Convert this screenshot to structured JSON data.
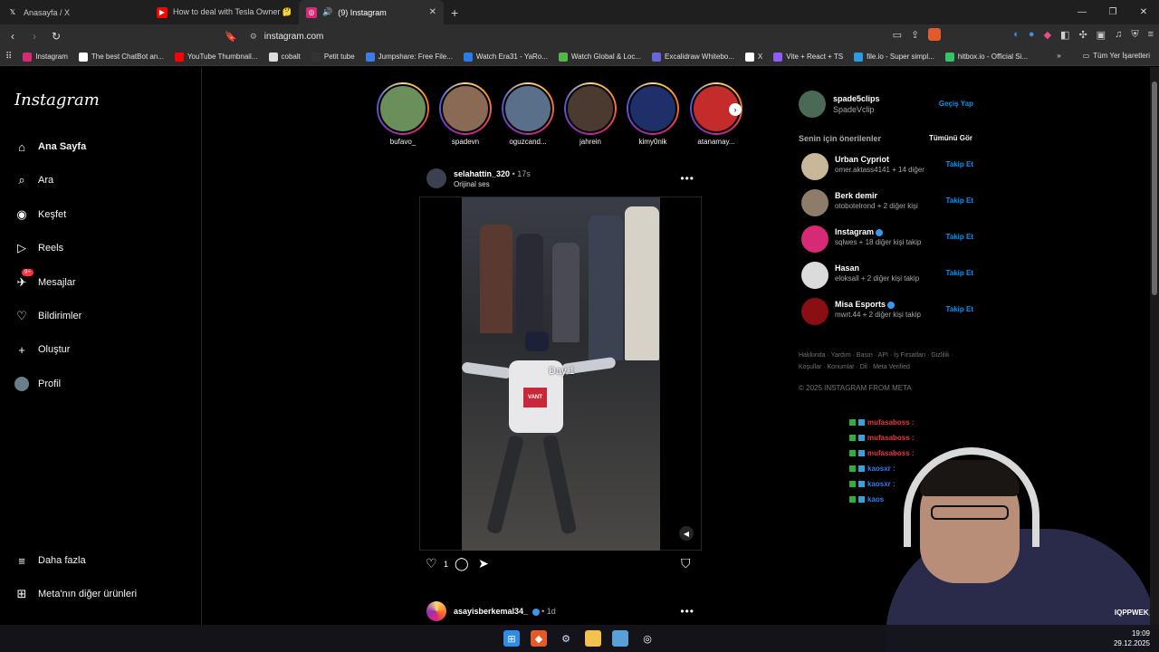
{
  "browser": {
    "tabs": [
      {
        "label": "Anasayfa / X",
        "icon": "x-icon"
      },
      {
        "label": "How to deal with Tesla Owner 🤔 #s",
        "icon": "youtube-icon"
      },
      {
        "label": "(9) Instagram",
        "icon": "instagram-icon"
      }
    ],
    "url": "instagram.com",
    "bookmarks": [
      {
        "label": "Instagram",
        "color": "#d62976"
      },
      {
        "label": "The best ChatBot an...",
        "color": "#ffffff"
      },
      {
        "label": "YouTube Thumbnail...",
        "color": "#ff0000"
      },
      {
        "label": "cobalt",
        "color": "#dddddd"
      },
      {
        "label": "Petit tube",
        "color": "#333333"
      },
      {
        "label": "Jumpshare: Free File...",
        "color": "#3d7be8"
      },
      {
        "label": "Watch Era31 - YaRo...",
        "color": "#2a7be4"
      },
      {
        "label": "Watch Global & Loc...",
        "color": "#53b848"
      },
      {
        "label": "Excalidraw Whitebo...",
        "color": "#6965db"
      },
      {
        "label": "X",
        "color": "#ffffff"
      },
      {
        "label": "Vite + React + TS",
        "color": "#8e5cf6"
      },
      {
        "label": "file.io - Super simpl...",
        "color": "#2c9be0"
      },
      {
        "label": "hitbox.io - Official Si...",
        "color": "#33c46a"
      }
    ],
    "all_bookmarks": "Tüm Yer İşaretleri"
  },
  "sidebar": {
    "logo": "Instagram",
    "items": [
      {
        "label": "Ana Sayfa",
        "icon": "home-icon"
      },
      {
        "label": "Ara",
        "icon": "search-icon"
      },
      {
        "label": "Keşfet",
        "icon": "compass-icon"
      },
      {
        "label": "Reels",
        "icon": "reels-icon"
      },
      {
        "label": "Mesajlar",
        "icon": "messenger-icon",
        "badge": "9+"
      },
      {
        "label": "Bildirimler",
        "icon": "heart-icon"
      },
      {
        "label": "Oluştur",
        "icon": "plus-icon"
      },
      {
        "label": "Profil",
        "icon": "avatar"
      }
    ],
    "more": "Daha fazla",
    "meta": "Meta'nın diğer ürünleri"
  },
  "stories": [
    {
      "name": "bufavo_",
      "color": "#6a8f5a"
    },
    {
      "name": "spadevn",
      "color": "#8a6a55"
    },
    {
      "name": "oguzcand...",
      "color": "#5a6f8a"
    },
    {
      "name": "jahrein",
      "color": "#4a3a30"
    },
    {
      "name": "kimy0nik",
      "color": "#1e2f6a"
    },
    {
      "name": "atanamay...",
      "color": "#c42b2b"
    }
  ],
  "post": {
    "user": "selahattin_320",
    "time": "• 17s",
    "audio": "Orijinal ses",
    "overlay_text": "Day 1",
    "robot_logo": "VANT",
    "likes": "1"
  },
  "post2": {
    "user": "asayisberkemal34_",
    "time": "• 1d"
  },
  "right": {
    "me_user": "spade5clips",
    "me_name": "SpadeVclip",
    "switch": "Geçiş Yap",
    "suggest_title": "Senin için önerilenler",
    "see_all": "Tümünü Gör",
    "suggestions": [
      {
        "name": "Urban Cypriot",
        "sub": "omer.aktass4141 + 14 diğer",
        "color": "#c9b79a",
        "verified": false
      },
      {
        "name": "Berk demir",
        "sub": "otobotelrond + 2 diğer kişi",
        "color": "#8f7b6a",
        "verified": false
      },
      {
        "name": "Instagram",
        "sub": "sqlwes + 18 diğer kişi takip",
        "color": "#d62976",
        "verified": true
      },
      {
        "name": "Hasan",
        "sub": "eloksall + 2 diğer kişi takip",
        "color": "#dbdbdb",
        "verified": false
      },
      {
        "name": "Misa Esports",
        "sub": "mwrt.44 + 2 diğer kişi takip",
        "color": "#8a0f14",
        "verified": true
      }
    ],
    "follow_label": "Takip Et",
    "footer": "Hakkında · Yardım · Basın · API · İş Fırsatları · Gizlilik · Koşullar · Konumlar · Dil · Meta Verified",
    "copyright": "© 2025 INSTAGRAM FROM META"
  },
  "chat": [
    {
      "user": "mufasaboss :",
      "color": "#e83a3a"
    },
    {
      "user": "mufasaboss :",
      "color": "#e83a3a"
    },
    {
      "user": "mufasaboss :",
      "color": "#e83a3a"
    },
    {
      "user": "kaosxr :",
      "color": "#3a7be8"
    },
    {
      "user": "kaosxr :",
      "color": "#3a7be8"
    },
    {
      "user": "kaos",
      "color": "#3a7be8"
    }
  ],
  "stream_name": "IQPPWEK_d",
  "clock": {
    "time": "19:09",
    "date": "29.12.2025"
  }
}
